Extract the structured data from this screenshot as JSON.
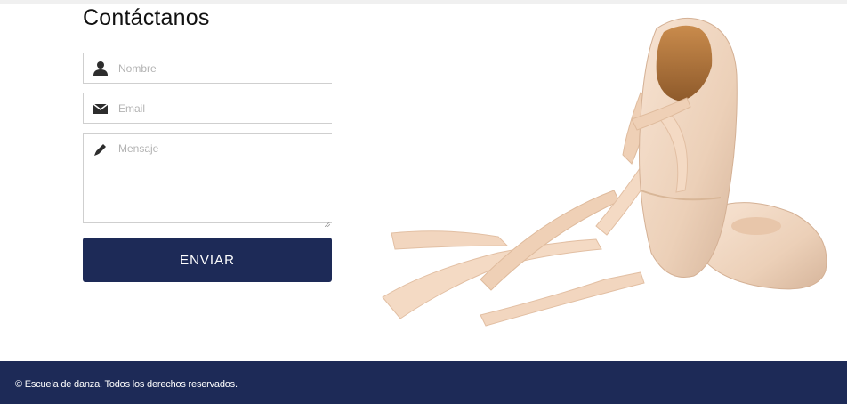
{
  "contact": {
    "title": "Contáctanos",
    "name_placeholder": "Nombre",
    "email_placeholder": "Email",
    "message_placeholder": "Mensaje",
    "submit_label": "ENVIAR"
  },
  "icons": {
    "name": "user-icon",
    "email": "envelope-icon",
    "message": "pencil-icon",
    "image": "ballet-shoes-image"
  },
  "footer": {
    "copyright": "© Escuela de danza. Todos los derechos reservados."
  },
  "colors": {
    "brand_navy": "#1d2a57",
    "field_border": "#cfcfcf",
    "shoe_satin": "#f3d7c0"
  }
}
